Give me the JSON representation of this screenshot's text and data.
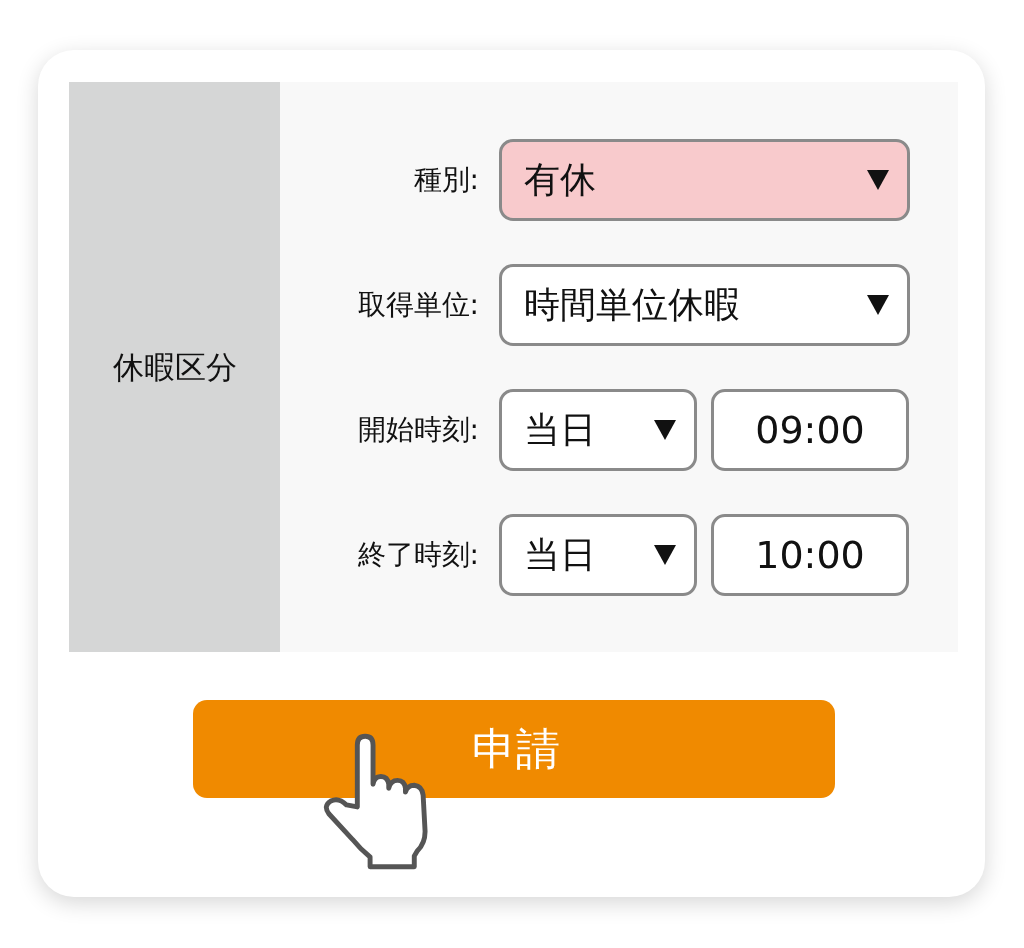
{
  "section": {
    "label": "休暇区分"
  },
  "rows": [
    {
      "label": "種別:",
      "controls": [
        {
          "kind": "select",
          "value": "有休",
          "highlighted": true
        }
      ]
    },
    {
      "label": "取得単位:",
      "controls": [
        {
          "kind": "select",
          "value": "時間単位休暇",
          "highlighted": false
        }
      ]
    },
    {
      "label": "開始時刻:",
      "controls": [
        {
          "kind": "select",
          "value": "当日",
          "highlighted": false
        },
        {
          "kind": "time",
          "value": "09:00",
          "highlighted": false
        }
      ]
    },
    {
      "label": "終了時刻:",
      "controls": [
        {
          "kind": "select",
          "value": "当日",
          "highlighted": false
        },
        {
          "kind": "time",
          "value": "10:00",
          "highlighted": false
        }
      ]
    }
  ],
  "submit": {
    "label": "申請"
  }
}
